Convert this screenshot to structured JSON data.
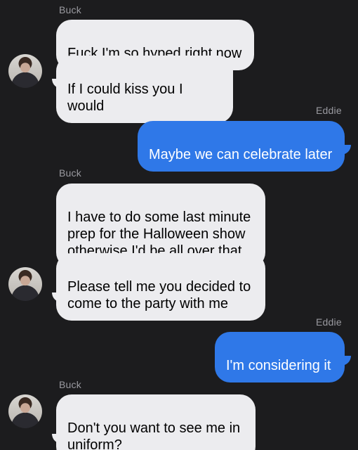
{
  "messages": [
    {
      "sender": "Buck"
    },
    {
      "text": "Fuck I'm so hyped right now"
    },
    {
      "text": "If I could kiss you I would"
    },
    {
      "sender": "Eddie"
    },
    {
      "text": "Maybe we can celebrate later"
    },
    {
      "sender": "Buck"
    },
    {
      "text": "I have to do some last minute\nprep for the Halloween show\notherwise I'd be all over that"
    },
    {
      "text": "Please tell me you decided to\ncome to the party with me"
    },
    {
      "sender": "Eddie"
    },
    {
      "text": "I'm considering it"
    },
    {
      "sender": "Buck"
    },
    {
      "text": "Don't you want to see me in\nuniform?"
    }
  ],
  "colors": {
    "background": "#1c1c1e",
    "incoming_bubble": "#ececef",
    "outgoing_bubble": "#2f78e8",
    "sender_name": "#9a9aa0"
  },
  "icons": {
    "avatar": "buck-avatar-photo"
  }
}
